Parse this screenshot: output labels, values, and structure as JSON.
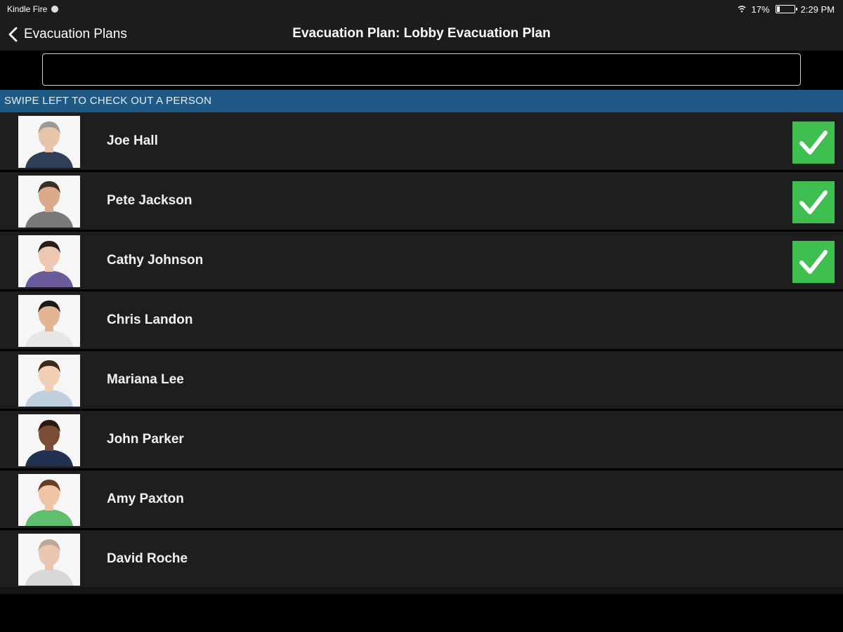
{
  "status_bar": {
    "device": "Kindle Fire",
    "battery": "17%",
    "battery_level": 0.17,
    "time": "2:29 PM"
  },
  "nav": {
    "back_label": "Evacuation Plans",
    "title": "Evacuation Plan: Lobby Evacuation Plan"
  },
  "search": {
    "value": "",
    "placeholder": ""
  },
  "section_header": "SWIPE LEFT TO CHECK OUT A PERSON",
  "people": [
    {
      "name": "Joe Hall",
      "checked": true,
      "hair": "#9a9a9a",
      "skin": "#e8c4a8",
      "shirt": "#2f3f5a"
    },
    {
      "name": "Pete Jackson",
      "checked": true,
      "hair": "#3a2e26",
      "skin": "#d9a98a",
      "shirt": "#7a7a7a"
    },
    {
      "name": "Cathy Johnson",
      "checked": true,
      "hair": "#2a1a1a",
      "skin": "#edc7b1",
      "shirt": "#6a5c9a"
    },
    {
      "name": "Chris Landon",
      "checked": false,
      "hair": "#1a1a1a",
      "skin": "#e2b494",
      "shirt": "#e6e6e6"
    },
    {
      "name": "Mariana Lee",
      "checked": false,
      "hair": "#3b2a1c",
      "skin": "#f0cfb5",
      "shirt": "#bfcfe0"
    },
    {
      "name": "John Parker",
      "checked": false,
      "hair": "#2a1a12",
      "skin": "#7a4e36",
      "shirt": "#233150"
    },
    {
      "name": "Amy Paxton",
      "checked": false,
      "hair": "#6a3a22",
      "skin": "#efc4a7",
      "shirt": "#5fbf6f"
    },
    {
      "name": "David Roche",
      "checked": false,
      "hair": "#c0a890",
      "skin": "#e9c6ad",
      "shirt": "#d8d8d8"
    }
  ],
  "colors": {
    "section_header_bg": "#1f5a87",
    "check_bg": "#3fbf4f",
    "row_bg": "#1e1e1e"
  }
}
